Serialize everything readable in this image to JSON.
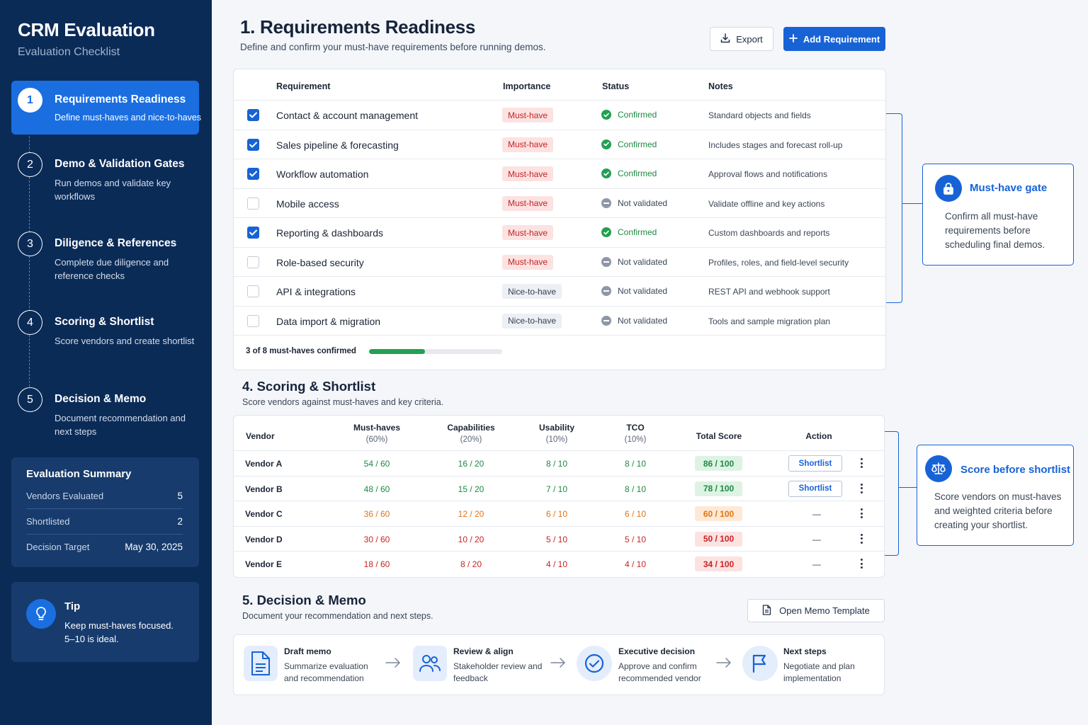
{
  "sidebar": {
    "title": "CRM Evaluation",
    "subtitle": "Evaluation Checklist",
    "steps": [
      {
        "num": "1",
        "title": "Requirements Readiness",
        "desc": "Define must-haves and nice-to-haves"
      },
      {
        "num": "2",
        "title": "Demo & Validation Gates",
        "desc": "Run demos and validate key workflows"
      },
      {
        "num": "3",
        "title": "Diligence & References",
        "desc": "Complete due diligence and reference checks"
      },
      {
        "num": "4",
        "title": "Scoring & Shortlist",
        "desc": "Score vendors and create shortlist"
      },
      {
        "num": "5",
        "title": "Decision & Memo",
        "desc": "Document recommendation and next steps"
      }
    ],
    "summary": {
      "title": "Evaluation Summary",
      "rows": [
        {
          "label": "Vendors Evaluated",
          "value": "5"
        },
        {
          "label": "Shortlisted",
          "value": "2"
        },
        {
          "label": "Decision Target",
          "value": "May 30, 2025"
        }
      ]
    },
    "tip": {
      "title": "Tip",
      "text": "Keep must-haves focused. 5–10 is ideal."
    }
  },
  "requirements": {
    "title": "1. Requirements Readiness",
    "subtitle": "Define and confirm your must-have requirements before running demos.",
    "export_label": "Export",
    "add_label": "Add Requirement",
    "headers": {
      "requirement": "Requirement",
      "importance": "Importance",
      "status": "Status",
      "notes": "Notes"
    },
    "rows": [
      {
        "checked": true,
        "name": "Contact & account management",
        "importance": "Must-have",
        "status": "Confirmed",
        "notes": "Standard objects and fields"
      },
      {
        "checked": true,
        "name": "Sales pipeline & forecasting",
        "importance": "Must-have",
        "status": "Confirmed",
        "notes": "Includes stages and forecast roll-up"
      },
      {
        "checked": true,
        "name": "Workflow automation",
        "importance": "Must-have",
        "status": "Confirmed",
        "notes": "Approval flows and notifications"
      },
      {
        "checked": false,
        "name": "Mobile access",
        "importance": "Must-have",
        "status": "Not validated",
        "notes": "Validate offline and key actions"
      },
      {
        "checked": true,
        "name": "Reporting & dashboards",
        "importance": "Must-have",
        "status": "Confirmed",
        "notes": "Custom dashboards and reports"
      },
      {
        "checked": false,
        "name": "Role-based security",
        "importance": "Must-have",
        "status": "Not validated",
        "notes": "Profiles, roles, and field-level security"
      },
      {
        "checked": false,
        "name": "API & integrations",
        "importance": "Nice-to-have",
        "status": "Not validated",
        "notes": "REST API and webhook support"
      },
      {
        "checked": false,
        "name": "Data import & migration",
        "importance": "Nice-to-have",
        "status": "Not validated",
        "notes": "Tools and sample migration plan"
      }
    ],
    "progress_label": "3 of 8 must-haves confirmed",
    "progress_fraction": 0.42
  },
  "callouts": {
    "gate": {
      "title": "Must-have gate",
      "text": "Confirm all must-have requirements before scheduling final demos."
    },
    "score": {
      "title": "Score before shortlist",
      "text": "Score vendors on must-haves and weighted criteria before creating your shortlist."
    }
  },
  "scoring": {
    "title": "4. Scoring & Shortlist",
    "subtitle": "Score vendors against must-haves and key criteria.",
    "headers": {
      "vendor": "Vendor",
      "musthaves": "Must-haves",
      "musthaves_w": "(60%)",
      "capabilities": "Capabilities",
      "capabilities_w": "(20%)",
      "usability": "Usability",
      "usability_w": "(10%)",
      "tco": "TCO",
      "tco_w": "(10%)",
      "total": "Total Score",
      "action": "Action"
    },
    "shortlist_label": "Shortlist",
    "dash": "—",
    "rows": [
      {
        "vendor": "Vendor A",
        "musthaves": "54 / 60",
        "capabilities": "16 / 20",
        "usability": "8 / 10",
        "tco": "8 / 10",
        "total": "86 / 100",
        "shortlisted": true
      },
      {
        "vendor": "Vendor B",
        "musthaves": "48 / 60",
        "capabilities": "15 / 20",
        "usability": "7 / 10",
        "tco": "8 / 10",
        "total": "78 / 100",
        "shortlisted": true
      },
      {
        "vendor": "Vendor C",
        "musthaves": "36 / 60",
        "capabilities": "12 / 20",
        "usability": "6 / 10",
        "tco": "6 / 10",
        "total": "60 / 100",
        "shortlisted": false
      },
      {
        "vendor": "Vendor D",
        "musthaves": "30 / 60",
        "capabilities": "10 / 20",
        "usability": "5 / 10",
        "tco": "5 / 10",
        "total": "50 / 100",
        "shortlisted": false
      },
      {
        "vendor": "Vendor E",
        "musthaves": "18 / 60",
        "capabilities": "8 / 20",
        "usability": "4 / 10",
        "tco": "4 / 10",
        "total": "34 / 100",
        "shortlisted": false
      }
    ]
  },
  "decision": {
    "title": "5. Decision & Memo",
    "subtitle": "Document your recommendation and next steps.",
    "memo_button": "Open Memo Template",
    "steps": [
      {
        "title": "Draft memo",
        "desc": "Summarize evaluation and recommendation"
      },
      {
        "title": "Review & align",
        "desc": "Stakeholder review and feedback"
      },
      {
        "title": "Executive decision",
        "desc": "Approve and confirm recommended vendor"
      },
      {
        "title": "Next steps",
        "desc": "Negotiate and plan implementation"
      }
    ]
  },
  "colors": {
    "sidebar": "#0b2b57",
    "accent": "#1763d6",
    "good": "#23a052",
    "warn": "#e07416",
    "bad": "#c82424"
  }
}
